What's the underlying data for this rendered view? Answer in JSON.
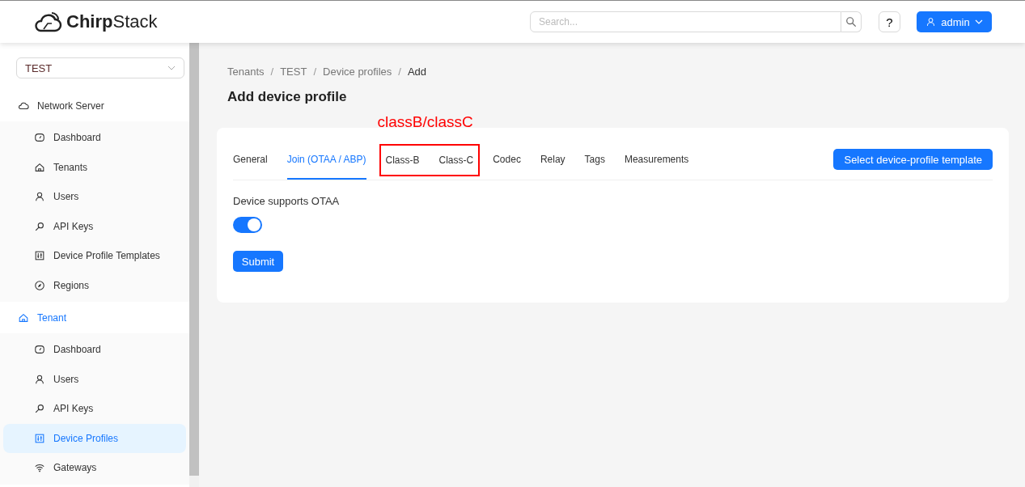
{
  "header": {
    "logo": {
      "text_regular": "Chirp",
      "text_light": "Stack"
    },
    "search": {
      "placeholder": "Search..."
    },
    "help": "?",
    "user_menu": "admin"
  },
  "sidebar": {
    "tenant_select": "TEST",
    "groups": [
      {
        "label": "Network Server",
        "kind": "cloud",
        "active": false,
        "items": [
          {
            "label": "Dashboard",
            "kind": "dashboard",
            "selected": false
          },
          {
            "label": "Tenants",
            "kind": "home",
            "selected": false
          },
          {
            "label": "Users",
            "kind": "user",
            "selected": false
          },
          {
            "label": "API Keys",
            "kind": "key",
            "selected": false
          },
          {
            "label": "Device Profile Templates",
            "kind": "sliders",
            "selected": false
          },
          {
            "label": "Regions",
            "kind": "compass",
            "selected": false
          }
        ]
      },
      {
        "label": "Tenant",
        "kind": "home",
        "active": true,
        "items": [
          {
            "label": "Dashboard",
            "kind": "dashboard",
            "selected": false
          },
          {
            "label": "Users",
            "kind": "user",
            "selected": false
          },
          {
            "label": "API Keys",
            "kind": "key",
            "selected": false
          },
          {
            "label": "Device Profiles",
            "kind": "sliders",
            "selected": true
          },
          {
            "label": "Gateways",
            "kind": "wifi",
            "selected": false
          }
        ]
      }
    ]
  },
  "breadcrumb": {
    "items": [
      "Tenants",
      "TEST",
      "Device profiles",
      "Add"
    ],
    "separators": [
      "/",
      "/",
      "/"
    ]
  },
  "page_title": "Add device profile",
  "tabs": [
    {
      "label": "General",
      "selected": false,
      "highlighted": false
    },
    {
      "label": "Join (OTAA / ABP)",
      "selected": true,
      "highlighted": false
    },
    {
      "label": "Class-B",
      "selected": false,
      "highlighted": true
    },
    {
      "label": "Class-C",
      "selected": false,
      "highlighted": true
    },
    {
      "label": "Codec",
      "selected": false,
      "highlighted": false
    },
    {
      "label": "Relay",
      "selected": false,
      "highlighted": false
    },
    {
      "label": "Tags",
      "selected": false,
      "highlighted": false
    },
    {
      "label": "Measurements",
      "selected": false,
      "highlighted": false
    }
  ],
  "annotation": {
    "text": "classB/classC"
  },
  "template_button": "Select device-profile template",
  "form": {
    "label": "Device supports OTAA",
    "otaa": {
      "on": true
    },
    "submit": "Submit"
  }
}
